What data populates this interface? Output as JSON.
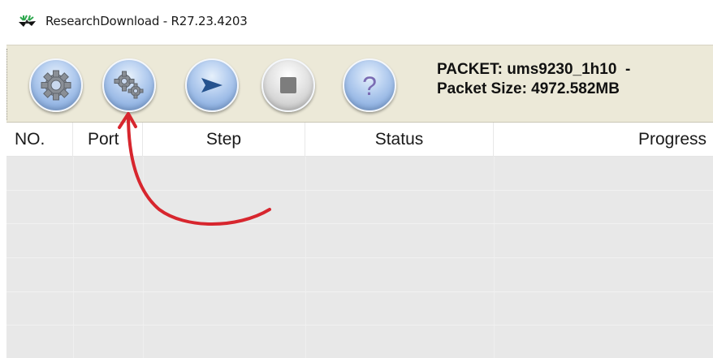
{
  "window": {
    "title": "ResearchDownload - R27.23.4203"
  },
  "toolbar": {
    "buttons": [
      {
        "name": "load-packet",
        "icon": "gear-icon"
      },
      {
        "name": "settings",
        "icon": "gears-icon"
      },
      {
        "name": "start-downloading",
        "icon": "play-arrow-icon"
      },
      {
        "name": "stop-downloading",
        "icon": "stop-square-icon"
      },
      {
        "name": "help",
        "icon": "question-icon"
      }
    ],
    "packet_line": "PACKET: ums9230_1h10  -",
    "size_line": "Packet Size: 4972.582MB"
  },
  "table": {
    "columns": [
      "NO.",
      "Port",
      "Step",
      "Status",
      "Progress"
    ],
    "rows": []
  },
  "annotation": {
    "color": "#d7262e",
    "icon": "curved-arrow-icon"
  }
}
